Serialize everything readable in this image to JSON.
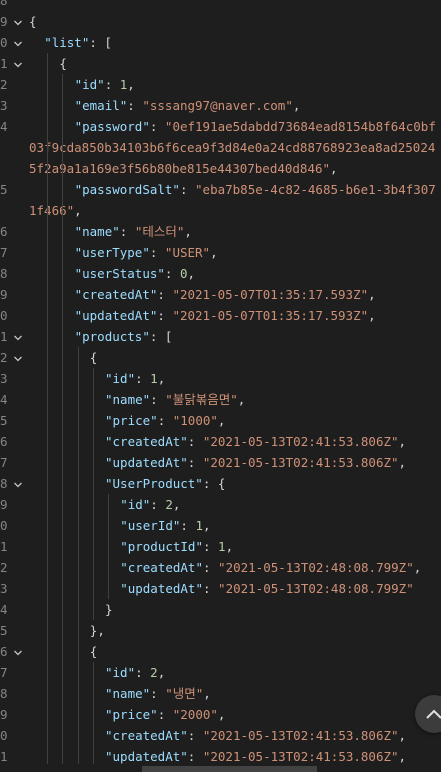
{
  "editor": {
    "lines": [
      {
        "ln": "8",
        "fold": "",
        "indent": 0,
        "tokens": []
      },
      {
        "ln": "9",
        "fold": "v",
        "indent": 0,
        "tokens": [
          {
            "c": "p",
            "t": "{"
          }
        ]
      },
      {
        "ln": "0",
        "fold": "v",
        "indent": 1,
        "tokens": [
          {
            "c": "k",
            "t": "\"list\""
          },
          {
            "c": "p",
            "t": ": ["
          }
        ]
      },
      {
        "ln": "1",
        "fold": "v",
        "indent": 2,
        "tokens": [
          {
            "c": "p",
            "t": "{"
          }
        ]
      },
      {
        "ln": "2",
        "fold": "",
        "indent": 3,
        "tokens": [
          {
            "c": "k",
            "t": "\"id\""
          },
          {
            "c": "p",
            "t": ": "
          },
          {
            "c": "n",
            "t": "1"
          },
          {
            "c": "p",
            "t": ","
          }
        ]
      },
      {
        "ln": "3",
        "fold": "",
        "indent": 3,
        "tokens": [
          {
            "c": "k",
            "t": "\"email\""
          },
          {
            "c": "p",
            "t": ": "
          },
          {
            "c": "s",
            "t": "\"sssang97@naver.com\""
          },
          {
            "c": "p",
            "t": ","
          }
        ]
      },
      {
        "ln": "4",
        "fold": "",
        "indent": 3,
        "tokens": [
          {
            "c": "k",
            "t": "\"password\""
          },
          {
            "c": "p",
            "t": ": "
          },
          {
            "c": "s",
            "t": "\"0ef191ae5dabdd73684ead8154b8f64c0bf"
          }
        ]
      },
      {
        "ln": "",
        "fold": "",
        "indent": 0,
        "tokens": [
          {
            "c": "s",
            "t": "03f9cda850b34103b6f6cea9f3d84e0a24cd88768923ea8ad25024"
          }
        ]
      },
      {
        "ln": "",
        "fold": "",
        "indent": 0,
        "tokens": [
          {
            "c": "s",
            "t": "5f2a9a1a169e3f56b80be815e44307bed40d846\""
          },
          {
            "c": "p",
            "t": ","
          }
        ]
      },
      {
        "ln": "5",
        "fold": "",
        "indent": 3,
        "tokens": [
          {
            "c": "k",
            "t": "\"passwordSalt\""
          },
          {
            "c": "p",
            "t": ": "
          },
          {
            "c": "s",
            "t": "\"eba7b85e-4c82-4685-b6e1-3b4f307"
          }
        ]
      },
      {
        "ln": "",
        "fold": "",
        "indent": 0,
        "tokens": [
          {
            "c": "s",
            "t": "1f466\""
          },
          {
            "c": "p",
            "t": ","
          }
        ]
      },
      {
        "ln": "6",
        "fold": "",
        "indent": 3,
        "tokens": [
          {
            "c": "k",
            "t": "\"name\""
          },
          {
            "c": "p",
            "t": ": "
          },
          {
            "c": "s",
            "t": "\"테스터\""
          },
          {
            "c": "p",
            "t": ","
          }
        ]
      },
      {
        "ln": "7",
        "fold": "",
        "indent": 3,
        "tokens": [
          {
            "c": "k",
            "t": "\"userType\""
          },
          {
            "c": "p",
            "t": ": "
          },
          {
            "c": "s",
            "t": "\"USER\""
          },
          {
            "c": "p",
            "t": ","
          }
        ]
      },
      {
        "ln": "8",
        "fold": "",
        "indent": 3,
        "tokens": [
          {
            "c": "k",
            "t": "\"userStatus\""
          },
          {
            "c": "p",
            "t": ": "
          },
          {
            "c": "n",
            "t": "0"
          },
          {
            "c": "p",
            "t": ","
          }
        ]
      },
      {
        "ln": "9",
        "fold": "",
        "indent": 3,
        "tokens": [
          {
            "c": "k",
            "t": "\"createdAt\""
          },
          {
            "c": "p",
            "t": ": "
          },
          {
            "c": "s",
            "t": "\"2021-05-07T01:35:17.593Z\""
          },
          {
            "c": "p",
            "t": ","
          }
        ]
      },
      {
        "ln": "0",
        "fold": "",
        "indent": 3,
        "tokens": [
          {
            "c": "k",
            "t": "\"updatedAt\""
          },
          {
            "c": "p",
            "t": ": "
          },
          {
            "c": "s",
            "t": "\"2021-05-07T01:35:17.593Z\""
          },
          {
            "c": "p",
            "t": ","
          }
        ]
      },
      {
        "ln": "1",
        "fold": "v",
        "indent": 3,
        "tokens": [
          {
            "c": "k",
            "t": "\"products\""
          },
          {
            "c": "p",
            "t": ": ["
          }
        ]
      },
      {
        "ln": "2",
        "fold": "v",
        "indent": 4,
        "tokens": [
          {
            "c": "p",
            "t": "{"
          }
        ]
      },
      {
        "ln": "3",
        "fold": "",
        "indent": 5,
        "tokens": [
          {
            "c": "k",
            "t": "\"id\""
          },
          {
            "c": "p",
            "t": ": "
          },
          {
            "c": "n",
            "t": "1"
          },
          {
            "c": "p",
            "t": ","
          }
        ]
      },
      {
        "ln": "4",
        "fold": "",
        "indent": 5,
        "tokens": [
          {
            "c": "k",
            "t": "\"name\""
          },
          {
            "c": "p",
            "t": ": "
          },
          {
            "c": "s",
            "t": "\"불닭볶음면\""
          },
          {
            "c": "p",
            "t": ","
          }
        ]
      },
      {
        "ln": "5",
        "fold": "",
        "indent": 5,
        "tokens": [
          {
            "c": "k",
            "t": "\"price\""
          },
          {
            "c": "p",
            "t": ": "
          },
          {
            "c": "s",
            "t": "\"1000\""
          },
          {
            "c": "p",
            "t": ","
          }
        ]
      },
      {
        "ln": "6",
        "fold": "",
        "indent": 5,
        "tokens": [
          {
            "c": "k",
            "t": "\"createdAt\""
          },
          {
            "c": "p",
            "t": ": "
          },
          {
            "c": "s",
            "t": "\"2021-05-13T02:41:53.806Z\""
          },
          {
            "c": "p",
            "t": ","
          }
        ]
      },
      {
        "ln": "7",
        "fold": "",
        "indent": 5,
        "tokens": [
          {
            "c": "k",
            "t": "\"updatedAt\""
          },
          {
            "c": "p",
            "t": ": "
          },
          {
            "c": "s",
            "t": "\"2021-05-13T02:41:53.806Z\""
          },
          {
            "c": "p",
            "t": ","
          }
        ]
      },
      {
        "ln": "8",
        "fold": "v",
        "indent": 5,
        "tokens": [
          {
            "c": "k",
            "t": "\"UserProduct\""
          },
          {
            "c": "p",
            "t": ": {"
          }
        ]
      },
      {
        "ln": "9",
        "fold": "",
        "indent": 6,
        "tokens": [
          {
            "c": "k",
            "t": "\"id\""
          },
          {
            "c": "p",
            "t": ": "
          },
          {
            "c": "n",
            "t": "2"
          },
          {
            "c": "p",
            "t": ","
          }
        ]
      },
      {
        "ln": "0",
        "fold": "",
        "indent": 6,
        "tokens": [
          {
            "c": "k",
            "t": "\"userId\""
          },
          {
            "c": "p",
            "t": ": "
          },
          {
            "c": "n",
            "t": "1"
          },
          {
            "c": "p",
            "t": ","
          }
        ]
      },
      {
        "ln": "1",
        "fold": "",
        "indent": 6,
        "tokens": [
          {
            "c": "k",
            "t": "\"productId\""
          },
          {
            "c": "p",
            "t": ": "
          },
          {
            "c": "n",
            "t": "1"
          },
          {
            "c": "p",
            "t": ","
          }
        ]
      },
      {
        "ln": "2",
        "fold": "",
        "indent": 6,
        "tokens": [
          {
            "c": "k",
            "t": "\"createdAt\""
          },
          {
            "c": "p",
            "t": ": "
          },
          {
            "c": "s",
            "t": "\"2021-05-13T02:48:08.799Z\""
          },
          {
            "c": "p",
            "t": ","
          }
        ]
      },
      {
        "ln": "3",
        "fold": "",
        "indent": 6,
        "tokens": [
          {
            "c": "k",
            "t": "\"updatedAt\""
          },
          {
            "c": "p",
            "t": ": "
          },
          {
            "c": "s",
            "t": "\"2021-05-13T02:48:08.799Z\""
          }
        ]
      },
      {
        "ln": "4",
        "fold": "",
        "indent": 5,
        "tokens": [
          {
            "c": "p",
            "t": "}"
          }
        ]
      },
      {
        "ln": "5",
        "fold": "",
        "indent": 4,
        "tokens": [
          {
            "c": "p",
            "t": "},"
          }
        ]
      },
      {
        "ln": "6",
        "fold": "v",
        "indent": 4,
        "tokens": [
          {
            "c": "p",
            "t": "{"
          }
        ]
      },
      {
        "ln": "7",
        "fold": "",
        "indent": 5,
        "tokens": [
          {
            "c": "k",
            "t": "\"id\""
          },
          {
            "c": "p",
            "t": ": "
          },
          {
            "c": "n",
            "t": "2"
          },
          {
            "c": "p",
            "t": ","
          }
        ]
      },
      {
        "ln": "8",
        "fold": "",
        "indent": 5,
        "tokens": [
          {
            "c": "k",
            "t": "\"name\""
          },
          {
            "c": "p",
            "t": ": "
          },
          {
            "c": "s",
            "t": "\"냉면\""
          },
          {
            "c": "p",
            "t": ","
          }
        ]
      },
      {
        "ln": "9",
        "fold": "",
        "indent": 5,
        "tokens": [
          {
            "c": "k",
            "t": "\"price\""
          },
          {
            "c": "p",
            "t": ": "
          },
          {
            "c": "s",
            "t": "\"2000\""
          },
          {
            "c": "p",
            "t": ","
          }
        ]
      },
      {
        "ln": "0",
        "fold": "",
        "indent": 5,
        "tokens": [
          {
            "c": "k",
            "t": "\"createdAt\""
          },
          {
            "c": "p",
            "t": ": "
          },
          {
            "c": "s",
            "t": "\"2021-05-13T02:41:53.806Z\""
          },
          {
            "c": "p",
            "t": ","
          }
        ]
      },
      {
        "ln": "1",
        "fold": "",
        "indent": 5,
        "tokens": [
          {
            "c": "k",
            "t": "\"updatedAt\""
          },
          {
            "c": "p",
            "t": ": "
          },
          {
            "c": "s",
            "t": "\"2021-05-13T02:41:53.806Z\""
          },
          {
            "c": "p",
            "t": ","
          }
        ]
      }
    ]
  },
  "colors": {
    "background": "#1e1e1e",
    "key": "#9cdcfe",
    "string": "#ce9178",
    "number": "#b5cea8",
    "punctuation": "#d4d4d4",
    "line_number": "#858585"
  },
  "icons": {
    "fold": "chevron-down-icon",
    "scroll_top": "chevron-up-icon"
  }
}
